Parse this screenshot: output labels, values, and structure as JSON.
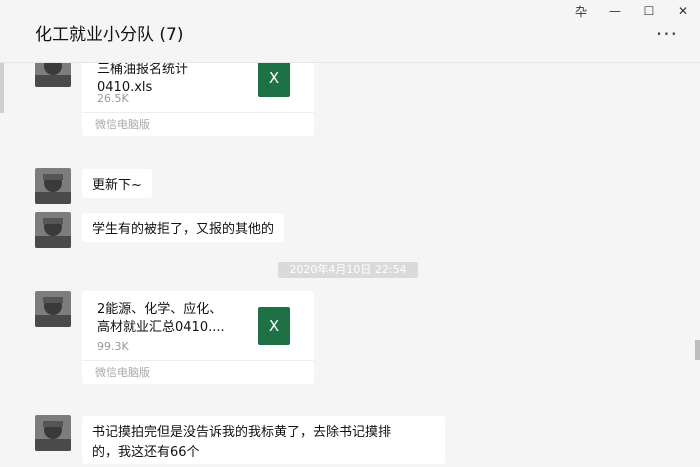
{
  "window": {
    "controls": [
      "pin-icon",
      "minimize-icon",
      "maximize-icon",
      "close-icon"
    ],
    "pin_glyph": "卆",
    "minimize_glyph": "—",
    "maximize_glyph": "☐",
    "close_glyph": "✕"
  },
  "header": {
    "title": "化工就业小分队 (7)",
    "more_glyph": "···"
  },
  "messages": [
    {
      "type": "file",
      "file_name": "三桶油报名统计0410.xls",
      "file_name_line1": "三桶油报名统计",
      "file_name_line2": "0410.xls",
      "size": "26.5K",
      "source": "微信电脑版",
      "icon": "excel-icon",
      "icon_glyph": "X"
    },
    {
      "type": "text",
      "text": "更新下~"
    },
    {
      "type": "text",
      "text": "学生有的被拒了，又报的其他的"
    },
    {
      "type": "timestamp",
      "text": "2020年4月10日 22:54"
    },
    {
      "type": "file",
      "file_name_line1": "2能源、化学、应化、",
      "file_name_line2": "高材就业汇总0410....",
      "size": "99.3K",
      "source": "微信电脑版",
      "icon": "excel-icon",
      "icon_glyph": "X"
    },
    {
      "type": "text",
      "text_line1": "书记摸拍完但是没告诉我的我标黄了，去除书记摸排",
      "text_line2": "的，我这还有66个"
    }
  ],
  "colors": {
    "background": "#f5f5f5",
    "bubble": "#ffffff",
    "excel": "#1e7145",
    "timestamp_bg": "#dadada"
  }
}
